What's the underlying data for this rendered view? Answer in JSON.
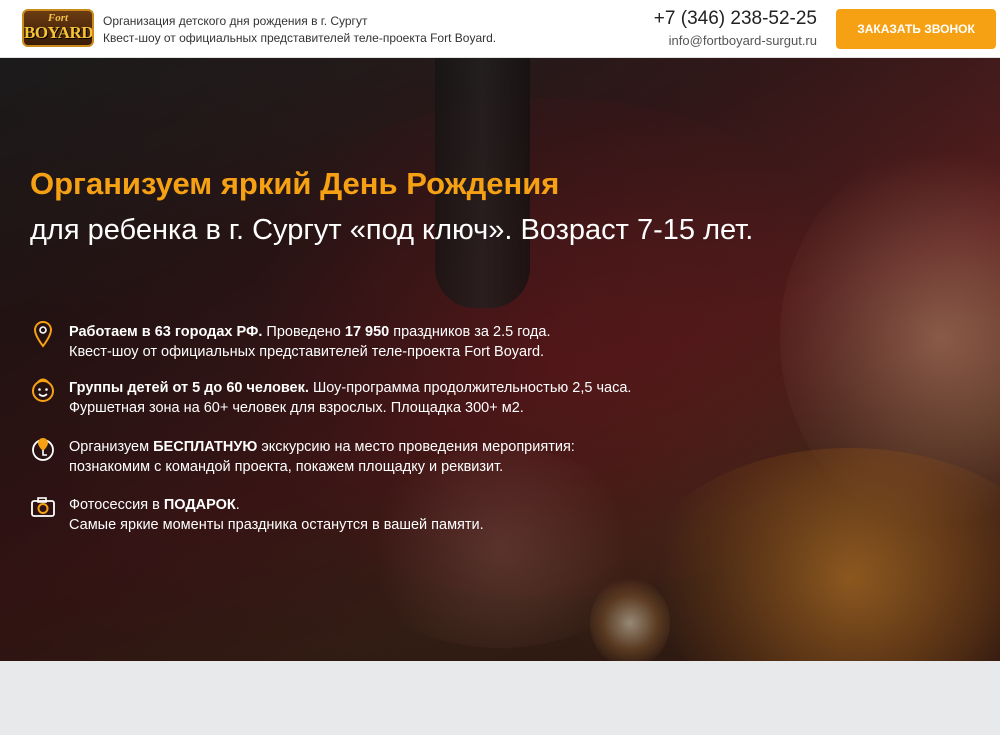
{
  "header": {
    "logo_line1": "Fort",
    "logo_line2": "BOYARD",
    "desc_line1": "Организация детского дня рождения в г. Сургут",
    "desc_line2": "Квест-шоу от официальных представителей теле-проекта Fort Boyard.",
    "phone": "+7 (346) 238-52-25",
    "email": "info@fortboyard-surgut.ru",
    "cta_label": "ЗАКАЗАТЬ ЗВОНОК"
  },
  "hero": {
    "title": "Организуем яркий День Рождения",
    "subtitle": "для ребенка в г. Сургут «под ключ». Возраст 7-15 лет."
  },
  "features": [
    {
      "icon": "location-pin-icon",
      "bold1": "Работаем в 63 городах РФ.",
      "t1": " Проведено ",
      "bold2": "17 950",
      "t2": " праздников за 2.5 года.",
      "line2": "Квест-шоу от официальных представителей теле-проекта Fort Boyard."
    },
    {
      "icon": "child-face-icon",
      "bold1": "Группы детей от 5 до 60 человек.",
      "t1": " Шоу-программа продолжительностью 2,5 часа.",
      "line2": "Фуршетная зона на 60+ человек для взрослых. Площадка 300+ м2."
    },
    {
      "icon": "clock-pin-icon",
      "t0": "Организуем ",
      "bold1": "БЕСПЛАТНУЮ",
      "t1": " экскурсию на место проведения мероприятия:",
      "line2": "познакомим с командой проекта, покажем площадку и реквизит."
    },
    {
      "icon": "camera-icon",
      "t0": "Фотосессия в ",
      "bold1": "ПОДАРОК",
      "t1": ".",
      "line2": "Самые яркие моменты праздника останутся в вашей памяти."
    }
  ],
  "colors": {
    "accent": "#f6a114",
    "header_bg": "#ffffff",
    "page_bg": "#e8e9ea"
  }
}
